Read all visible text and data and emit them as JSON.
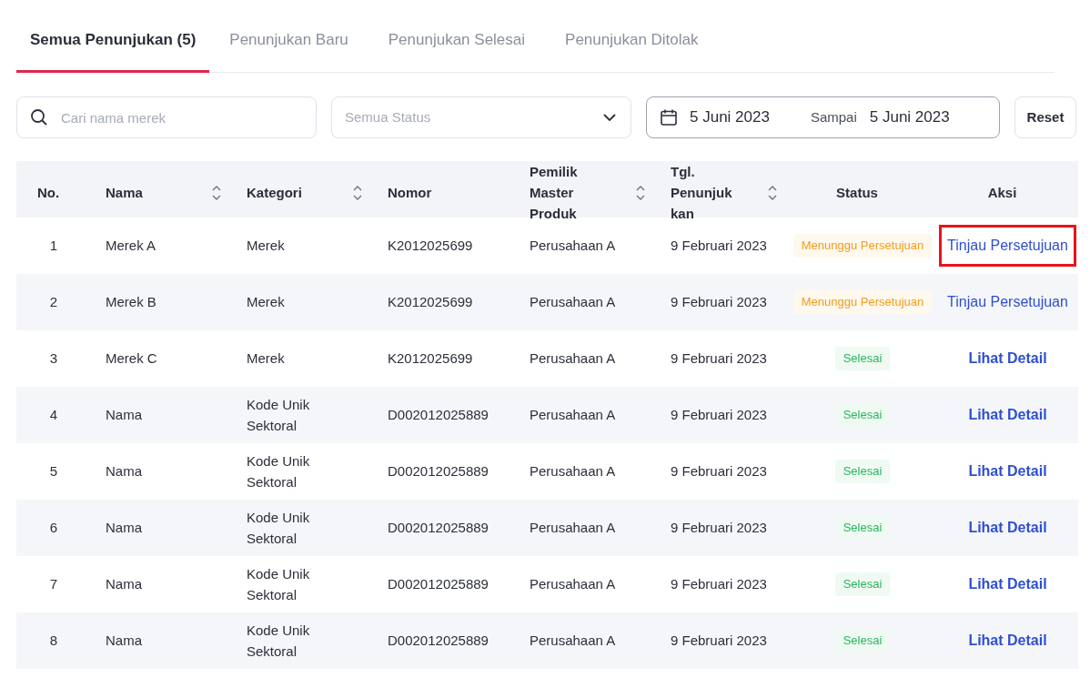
{
  "tabs": [
    {
      "label": "Semua Penunjukan (5)",
      "selected": true
    },
    {
      "label": "Penunjukan Baru",
      "selected": false
    },
    {
      "label": "Penunjukan Selesai",
      "selected": false
    },
    {
      "label": "Penunjukan Ditolak",
      "selected": false
    }
  ],
  "filters": {
    "search": {
      "placeholder": "Cari nama merek"
    },
    "status": {
      "placeholder": "Semua Status"
    },
    "date_from": "5 Juni 2023",
    "date_separator": "Sampai",
    "date_to": "5 Juni 2023",
    "reset": "Reset"
  },
  "table": {
    "columns": [
      {
        "label": "No.",
        "sortable": false
      },
      {
        "label": "Nama",
        "sortable": true
      },
      {
        "label": "Kategori",
        "sortable": true
      },
      {
        "label": "Nomor",
        "sortable": false
      },
      {
        "label": "Pemilik Master Produk",
        "sortable": true
      },
      {
        "label": "Tgl. Penunjuk kan",
        "sortable": true
      },
      {
        "label": "Status",
        "sortable": false
      },
      {
        "label": "Aksi",
        "sortable": false
      }
    ],
    "rows": [
      {
        "no": "1",
        "nama": "Merek A",
        "kategori": "Merek",
        "nomor": "K2012025699",
        "pemilik": "Perusahaan A",
        "tanggal": "9 Februari 2023",
        "status": {
          "label": "Menunggu Persetujuan",
          "kind": "pending"
        },
        "action": {
          "label": "Tinjau Persetujuan",
          "kind": "review",
          "highlighted": true
        }
      },
      {
        "no": "2",
        "nama": "Merek B",
        "kategori": "Merek",
        "nomor": "K2012025699",
        "pemilik": "Perusahaan A",
        "tanggal": "9 Februari 2023",
        "status": {
          "label": "Menunggu Persetujuan",
          "kind": "pending"
        },
        "action": {
          "label": "Tinjau Persetujuan",
          "kind": "review",
          "highlighted": false
        }
      },
      {
        "no": "3",
        "nama": "Merek C",
        "kategori": "Merek",
        "nomor": "K2012025699",
        "pemilik": "Perusahaan A",
        "tanggal": "9 Februari 2023",
        "status": {
          "label": "Selesai",
          "kind": "done"
        },
        "action": {
          "label": "Lihat Detail",
          "kind": "detail",
          "highlighted": false
        }
      },
      {
        "no": "4",
        "nama": "Nama",
        "kategori": "Kode Unik Sektoral",
        "nomor": "D002012025889",
        "pemilik": "Perusahaan A",
        "tanggal": "9 Februari 2023",
        "status": {
          "label": "Selesai",
          "kind": "done"
        },
        "action": {
          "label": "Lihat Detail",
          "kind": "detail",
          "highlighted": false
        }
      },
      {
        "no": "5",
        "nama": "Nama",
        "kategori": "Kode Unik Sektoral",
        "nomor": "D002012025889",
        "pemilik": "Perusahaan A",
        "tanggal": "9 Februari 2023",
        "status": {
          "label": "Selesai",
          "kind": "done"
        },
        "action": {
          "label": "Lihat Detail",
          "kind": "detail",
          "highlighted": false
        }
      },
      {
        "no": "6",
        "nama": "Nama",
        "kategori": "Kode Unik Sektoral",
        "nomor": "D002012025889",
        "pemilik": "Perusahaan A",
        "tanggal": "9 Februari 2023",
        "status": {
          "label": "Selesai",
          "kind": "done"
        },
        "action": {
          "label": "Lihat Detail",
          "kind": "detail",
          "highlighted": false
        }
      },
      {
        "no": "7",
        "nama": "Nama",
        "kategori": "Kode Unik Sektoral",
        "nomor": "D002012025889",
        "pemilik": "Perusahaan A",
        "tanggal": "9 Februari 2023",
        "status": {
          "label": "Selesai",
          "kind": "done"
        },
        "action": {
          "label": "Lihat Detail",
          "kind": "detail",
          "highlighted": false
        }
      },
      {
        "no": "8",
        "nama": "Nama",
        "kategori": "Kode Unik Sektoral",
        "nomor": "D002012025889",
        "pemilik": "Perusahaan A",
        "tanggal": "9 Februari 2023",
        "status": {
          "label": "Selesai",
          "kind": "done"
        },
        "action": {
          "label": "Lihat Detail",
          "kind": "detail",
          "highlighted": false
        }
      }
    ]
  }
}
